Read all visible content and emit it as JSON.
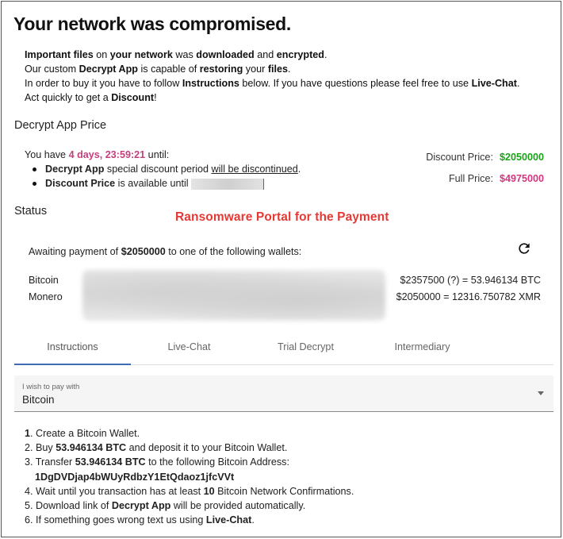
{
  "header": {
    "title": "Your network was compromised."
  },
  "intro": {
    "line1": {
      "a": "Important files",
      "b": " on ",
      "c": "your network",
      "d": " was ",
      "e": "downloaded",
      "f": " and ",
      "g": "encrypted",
      "h": "."
    },
    "line2": {
      "a": "Our custom ",
      "b": "Decrypt App",
      "c": " is capable of ",
      "d": "restoring",
      "e": " your ",
      "f": "files",
      "g": "."
    },
    "line3": {
      "a": "In order to buy it you have to follow ",
      "b": "Instructions",
      "c": " below. If you have questions please feel free to use ",
      "d": "Live-Chat",
      "e": "."
    },
    "line4": {
      "a": "Act quickly to get a ",
      "b": "Discount",
      "c": "!"
    }
  },
  "price_section": {
    "heading": "Decrypt App Price",
    "you_have": "You have ",
    "timer": "4 days, 23:59:21",
    "until": " until:",
    "bullet1": {
      "a": "Decrypt App",
      "b": " special discount period ",
      "c": "will be discontinued",
      "d": "."
    },
    "bullet2": {
      "a": "Discount Price",
      "b": " is available until"
    },
    "discount_label": "Discount Price:",
    "discount_value": "$2050000",
    "full_label": "Full Price:",
    "full_value": "$4975000",
    "colors": {
      "discount": "#1aa31a",
      "full": "#d6357f",
      "timer": "#c2407e"
    }
  },
  "caption": {
    "text": "Ransomware Portal for the Payment",
    "color": "#e53935"
  },
  "status": {
    "heading": "Status",
    "awaiting_a": "Awaiting payment of ",
    "awaiting_amount": "$2050000",
    "awaiting_b": " to one of the following wallets:",
    "refresh_icon": "refresh-icon",
    "wallets": [
      {
        "name": "Bitcoin",
        "amount": "$2357500 (?) = 53.946134 BTC"
      },
      {
        "name": "Monero",
        "amount": "$2050000 = 12316.750782 XMR"
      }
    ]
  },
  "tabs": [
    {
      "label": "Instructions",
      "active": true
    },
    {
      "label": "Live-Chat",
      "active": false
    },
    {
      "label": "Trial Decrypt",
      "active": false
    },
    {
      "label": "Intermediary",
      "active": false
    }
  ],
  "pay_select": {
    "label": "I wish to pay with",
    "value": "Bitcoin"
  },
  "steps": {
    "s1": {
      "n": "1",
      "a": ". Create a Bitcoin Wallet."
    },
    "s2": {
      "n": "2. Buy ",
      "b": "53.946134 BTC",
      "c": " and deposit it to your Bitcoin Wallet."
    },
    "s3": {
      "n": "3. Transfer ",
      "b": "53.946134 BTC",
      "c": " to the following Bitcoin Address:"
    },
    "address": "1DgDVDjap4bWUyRdbzY1EtQdaoz1jfcVVt",
    "s4": {
      "n": "4. Wait until you transaction has at least ",
      "b": "10",
      "c": " Bitcoin Network Confirmations."
    },
    "s5": {
      "n": "5. Download link of ",
      "b": "Decrypt App",
      "c": " will be provided automatically."
    },
    "s6": {
      "n": "6. If something goes wrong text us using ",
      "b": "Live-Chat",
      "c": "."
    }
  }
}
